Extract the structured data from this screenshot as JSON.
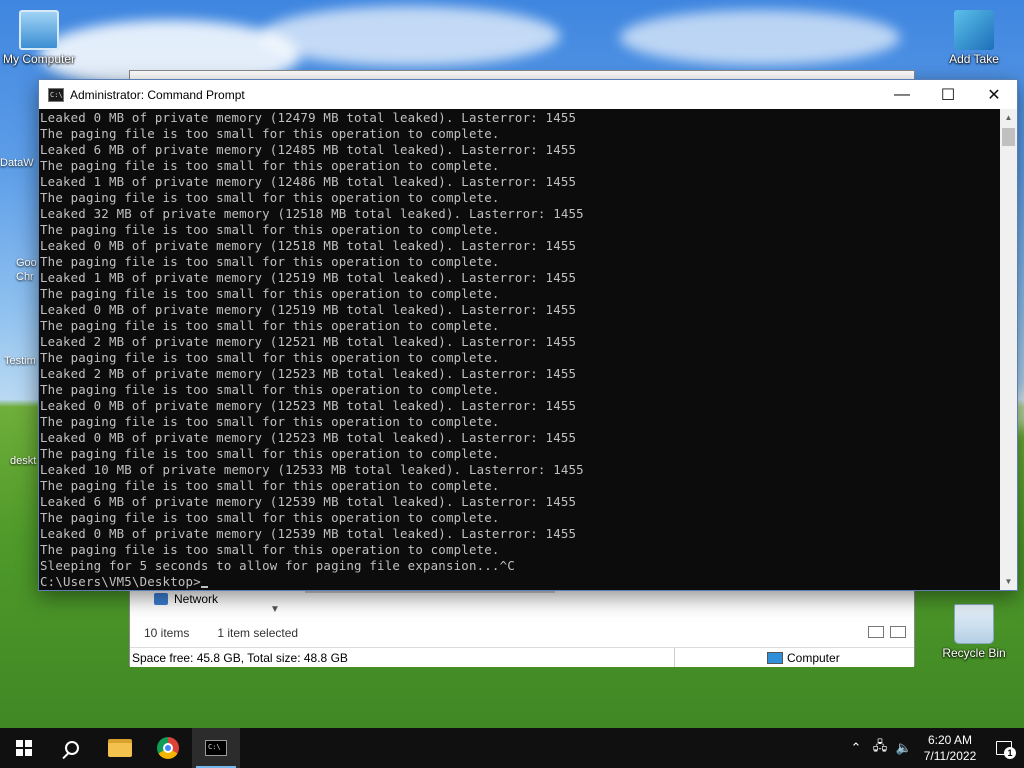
{
  "desktop": {
    "icons": {
      "my_computer": "My Computer",
      "add_take": "Add Take",
      "recycle_bin": "Recycle Bin"
    },
    "partial_labels": [
      "DataW",
      "Goo",
      "Chr",
      "Testim",
      "deskt"
    ]
  },
  "explorer": {
    "nav_item": "Network",
    "items_count": "10 items",
    "selection": "1 item selected",
    "space": "Space free: 45.8 GB, Total size: 48.8 GB",
    "location": "Computer"
  },
  "cmd": {
    "title": "Administrator: Command Prompt",
    "icon_text": "C:\\",
    "lines": [
      "Leaked 0 MB of private memory (12479 MB total leaked). Lasterror: 1455",
      "The paging file is too small for this operation to complete.",
      "Leaked 6 MB of private memory (12485 MB total leaked). Lasterror: 1455",
      "The paging file is too small for this operation to complete.",
      "Leaked 1 MB of private memory (12486 MB total leaked). Lasterror: 1455",
      "The paging file is too small for this operation to complete.",
      "Leaked 32 MB of private memory (12518 MB total leaked). Lasterror: 1455",
      "The paging file is too small for this operation to complete.",
      "Leaked 0 MB of private memory (12518 MB total leaked). Lasterror: 1455",
      "The paging file is too small for this operation to complete.",
      "Leaked 1 MB of private memory (12519 MB total leaked). Lasterror: 1455",
      "The paging file is too small for this operation to complete.",
      "Leaked 0 MB of private memory (12519 MB total leaked). Lasterror: 1455",
      "The paging file is too small for this operation to complete.",
      "Leaked 2 MB of private memory (12521 MB total leaked). Lasterror: 1455",
      "The paging file is too small for this operation to complete.",
      "Leaked 2 MB of private memory (12523 MB total leaked). Lasterror: 1455",
      "The paging file is too small for this operation to complete.",
      "Leaked 0 MB of private memory (12523 MB total leaked). Lasterror: 1455",
      "The paging file is too small for this operation to complete.",
      "Leaked 0 MB of private memory (12523 MB total leaked). Lasterror: 1455",
      "The paging file is too small for this operation to complete.",
      "Leaked 10 MB of private memory (12533 MB total leaked). Lasterror: 1455",
      "The paging file is too small for this operation to complete.",
      "Leaked 6 MB of private memory (12539 MB total leaked). Lasterror: 1455",
      "The paging file is too small for this operation to complete.",
      "Leaked 0 MB of private memory (12539 MB total leaked). Lasterror: 1455",
      "The paging file is too small for this operation to complete.",
      "Sleeping for 5 seconds to allow for paging file expansion...^C"
    ],
    "prompt": "C:\\Users\\VM5\\Desktop>",
    "buttons": {
      "minimize": "—",
      "maximize": "☐",
      "close": "✕"
    }
  },
  "taskbar": {
    "time": "6:20 AM",
    "date": "7/11/2022",
    "notification_count": "1",
    "tray_icons": [
      "chevron-up-icon",
      "network-icon",
      "volume-icon"
    ],
    "apps": [
      "start-icon",
      "search-icon",
      "file-explorer-icon",
      "chrome-icon",
      "command-prompt-icon"
    ],
    "icon_text": "C:\\"
  },
  "colors": {
    "console_bg": "#0c0c0c",
    "console_text": "#c0c0c0",
    "taskbar_bg": "#101010",
    "accent": "#76b9ed"
  }
}
